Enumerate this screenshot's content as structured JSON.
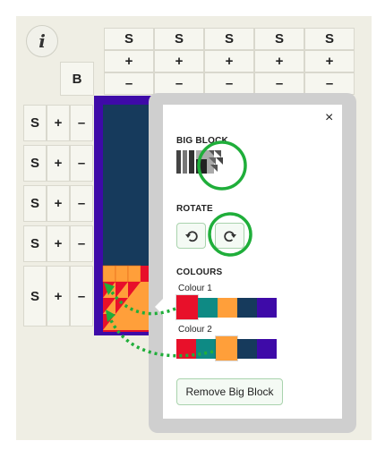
{
  "info_label": "i",
  "column_controls": {
    "size_label": "S",
    "add_label": "+",
    "remove_label": "–"
  },
  "block_button_label": "B",
  "row_controls": {
    "size_label": "S",
    "add_label": "+",
    "remove_label": "–"
  },
  "popup": {
    "close_label": "×",
    "big_block_title": "BIG BLOCK",
    "rotate_title": "ROTATE",
    "colours_title": "COLOURS",
    "colour1_label": "Colour 1",
    "colour2_label": "Colour 2",
    "remove_button_label": "Remove Big Block",
    "palette": [
      "#e8102a",
      "#0e8a84",
      "#ff9f3a",
      "#163a5c",
      "#3e0aa8"
    ],
    "colour1_selected": "#e8102a",
    "colour2_selected": "#ff9f3a"
  },
  "colors": {
    "quilt_border": "#3e0aa8",
    "quilt_fill": "#163a5c",
    "highlight_circle": "#1fae3a",
    "arrow": "#1fae3a"
  },
  "icons": [
    "info-icon",
    "rotate-left-icon",
    "rotate-right-icon",
    "close-icon",
    "big-block-pattern-icon"
  ]
}
